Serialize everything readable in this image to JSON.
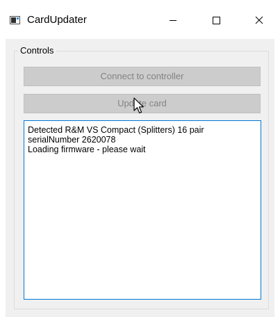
{
  "window": {
    "title": "CardUpdater",
    "icon": "app-window-icon",
    "minimize_icon": "minimize-icon",
    "maximize_icon": "maximize-icon",
    "close_icon": "close-icon"
  },
  "controls": {
    "group_label": "Controls",
    "connect_label": "Connect to controller",
    "update_label": "Update card",
    "connect_enabled": false,
    "update_enabled": false
  },
  "log": {
    "lines": [
      "Detected R&M VS Compact (Splitters)  16 pair",
      "serialNumber 2620078",
      "Loading firmware - please wait"
    ]
  },
  "colors": {
    "client_background": "#f0f0f0",
    "disabled_button": "#cccccc",
    "disabled_text": "#838383",
    "focus_border": "#0078d7"
  }
}
